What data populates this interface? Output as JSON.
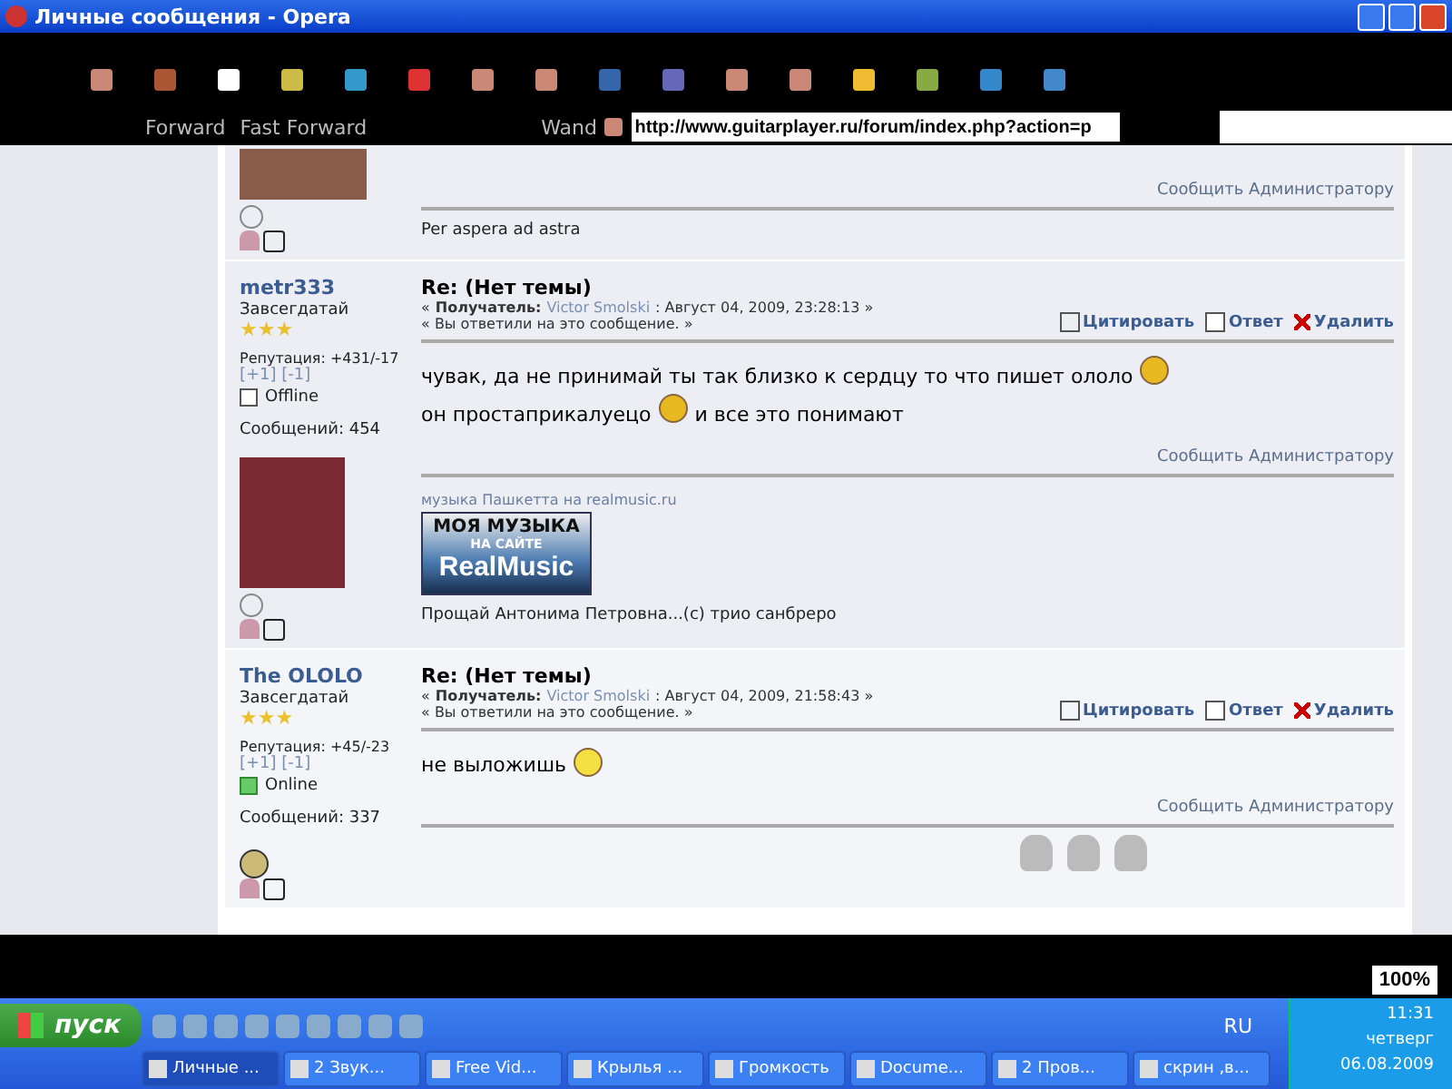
{
  "window": {
    "title": "Личные сообщения - Opera"
  },
  "toolbar": {
    "buttons": [
      {
        "label": "Forward"
      },
      {
        "label": "Fast Forward"
      },
      {
        "label": "Wand"
      }
    ],
    "address": "http://www.guitarplayer.ru/forum/index.php?action=p",
    "zoom": "100%"
  },
  "top_post": {
    "report": "Сообщить Администратору",
    "signature": "Per aspera ad astra"
  },
  "posts": [
    {
      "author": "metr333",
      "rank": "Завсегдатай",
      "stars": 3,
      "reputation": "Репутация: +431/-17",
      "rep_plus": "[+1]",
      "rep_minus": "[-1]",
      "online": false,
      "status": "Offline",
      "count": "Сообщений: 454",
      "avatar": {
        "kind": "photo"
      },
      "title": "Re: (Нет темы)",
      "open_quote": "«",
      "recipient_label": "Получатель:",
      "recipient": "Victor Smolski",
      "date": ": Август 04, 2009, 23:28:13 »",
      "replied": "« Вы ответили на это сообщение. »",
      "actions": [
        "Цитировать",
        "Ответ",
        "Удалить"
      ],
      "body": [
        [
          {
            "kind": "text",
            "text": "чувак, да не принимай ты так близко к сердцу то что пишет ололо"
          },
          {
            "kind": "smiley"
          }
        ],
        [
          {
            "kind": "text",
            "text": "он простаприкалуецо"
          },
          {
            "kind": "smiley"
          },
          {
            "kind": "text",
            "text": "и все это понимают"
          }
        ]
      ],
      "report": "Сообщить Администратору",
      "sig_link": "музыка Пашкетта на realmusic.ru",
      "banner": [
        "МОЯ МУЗЫКА",
        "НА САЙТЕ",
        "RealMusic"
      ],
      "sig_text": "Прощай Антонима Петровна...(с) трио санбреро"
    },
    {
      "author": "The OLOLO",
      "rank": "Завсегдатай",
      "stars": 3,
      "reputation": "Репутация: +45/-23",
      "rep_plus": "[+1]",
      "rep_minus": "[-1]",
      "online": true,
      "status": "Online",
      "count": "Сообщений: 337",
      "avatar": {
        "kind": "icon"
      },
      "title": "Re: (Нет темы)",
      "open_quote": "«",
      "recipient_label": "Получатель:",
      "recipient": "Victor Smolski",
      "date": ": Август 04, 2009, 21:58:43 »",
      "replied": "« Вы ответили на это сообщение. »",
      "actions": [
        "Цитировать",
        "Ответ",
        "Удалить"
      ],
      "body": [
        [
          {
            "kind": "text",
            "text": "не выложишь"
          },
          {
            "kind": "facepalm"
          }
        ]
      ],
      "report": "Сообщить Администратору"
    }
  ],
  "taskbar": {
    "start": "пуск",
    "tasks": [
      {
        "label": "Личные ...",
        "selected": true
      },
      {
        "label": "2 Звук...",
        "selected": false
      },
      {
        "label": "Free Vid...",
        "selected": false
      },
      {
        "label": "Крылья ...",
        "selected": false
      },
      {
        "label": "Громкость",
        "selected": false
      },
      {
        "label": "Docume...",
        "selected": false
      },
      {
        "label": "2 Пров...",
        "selected": false
      },
      {
        "label": "скрин ,в...",
        "selected": false
      }
    ],
    "language": "RU",
    "time": "11:31",
    "day": "четверг",
    "date": "06.08.2009"
  }
}
